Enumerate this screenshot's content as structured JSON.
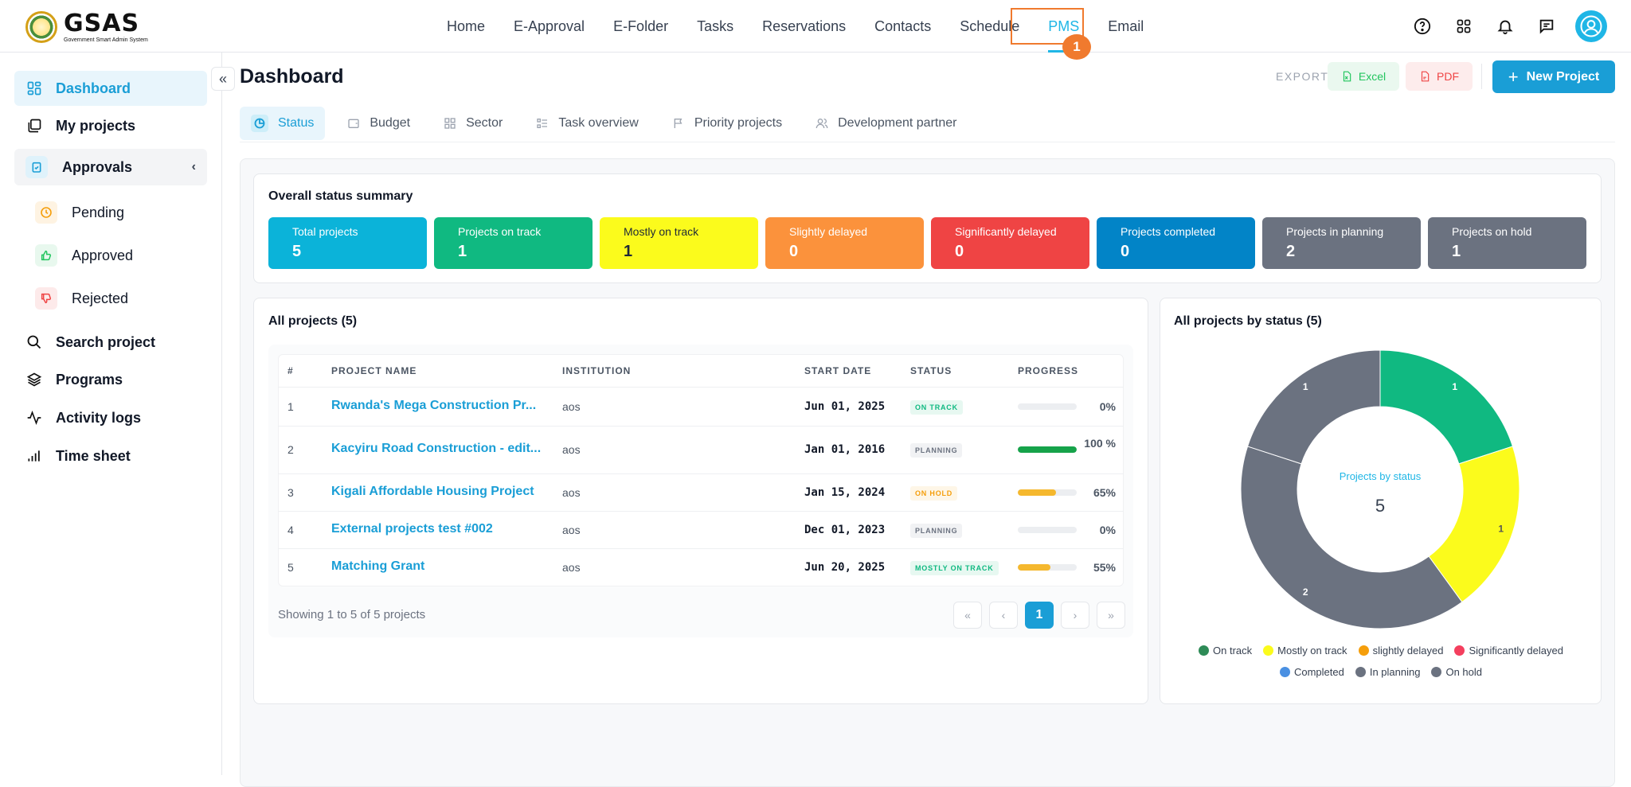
{
  "brand": {
    "title": "GSAS",
    "subtitle": "Government Smart Admin System"
  },
  "nav": [
    {
      "label": "Home",
      "active": false
    },
    {
      "label": "E-Approval",
      "active": false
    },
    {
      "label": "E-Folder",
      "active": false
    },
    {
      "label": "Tasks",
      "active": false
    },
    {
      "label": "Reservations",
      "active": false
    },
    {
      "label": "Contacts",
      "active": false
    },
    {
      "label": "Schedule",
      "active": false
    },
    {
      "label": "PMS",
      "active": true
    },
    {
      "label": "Email",
      "active": false
    }
  ],
  "annotation_badge": "1",
  "top_icons": [
    "help-icon",
    "apps-grid-icon",
    "bell-icon",
    "chat-icon",
    "user-avatar-icon"
  ],
  "sidebar": {
    "items": [
      {
        "label": "Dashboard",
        "icon": "dashboard-icon"
      },
      {
        "label": "My projects",
        "icon": "folders-icon"
      },
      {
        "label": "Approvals",
        "icon": "clipboard-check-icon"
      },
      {
        "label": "Search project",
        "icon": "search-icon"
      },
      {
        "label": "Programs",
        "icon": "layers-icon"
      },
      {
        "label": "Activity logs",
        "icon": "activity-icon"
      },
      {
        "label": "Time sheet",
        "icon": "bar-chart-icon"
      }
    ],
    "approvals_sub": [
      {
        "label": "Pending",
        "icon": "clock-icon",
        "color": "#f59e0b"
      },
      {
        "label": "Approved",
        "icon": "thumbs-up-icon",
        "color": "#22c55e"
      },
      {
        "label": "Rejected",
        "icon": "thumbs-down-icon",
        "color": "#ef4444"
      }
    ]
  },
  "page": {
    "title": "Dashboard",
    "export_label": "EXPORT",
    "excel_label": "Excel",
    "pdf_label": "PDF",
    "new_project_label": "New Project"
  },
  "tabs": [
    {
      "label": "Status",
      "icon": "pie-icon",
      "active": true
    },
    {
      "label": "Budget",
      "icon": "wallet-icon",
      "active": false
    },
    {
      "label": "Sector",
      "icon": "grid-icon",
      "active": false
    },
    {
      "label": "Task overview",
      "icon": "list-icon",
      "active": false
    },
    {
      "label": "Priority projects",
      "icon": "flag-icon",
      "active": false
    },
    {
      "label": "Development partner",
      "icon": "users-icon",
      "active": false
    }
  ],
  "summary": {
    "title": "Overall status summary",
    "stats": [
      {
        "label": "Total projects",
        "value": "5",
        "color": "#0bb3d9"
      },
      {
        "label": "Projects on track",
        "value": "1",
        "color": "#10b981"
      },
      {
        "label": "Mostly on track",
        "value": "1",
        "color": "#fbfb1c"
      },
      {
        "label": "Slightly delayed",
        "value": "0",
        "color": "#fb923c"
      },
      {
        "label": "Significantly delayed",
        "value": "0",
        "color": "#ef4444"
      },
      {
        "label": "Projects completed",
        "value": "0",
        "color": "#0284c7"
      },
      {
        "label": "Projects in planning",
        "value": "2",
        "color": "#6b7280"
      },
      {
        "label": "Projects on hold",
        "value": "1",
        "color": "#6b7280"
      }
    ]
  },
  "projects": {
    "title": "All projects (5)",
    "columns": [
      "#",
      "PROJECT NAME",
      "INSTITUTION",
      "START DATE",
      "STATUS",
      "PROGRESS"
    ],
    "rows": [
      {
        "num": "1",
        "name": "Rwanda's Mega Construction Pr...",
        "institution": "aos",
        "start": "Jun 01, 2025",
        "status": "ON TRACK",
        "status_color": "#10b981",
        "status_bg": "#e7f8f1",
        "progress": 0,
        "progress_label": "0%",
        "bar_color": "#d1d5db"
      },
      {
        "num": "2",
        "name": "Kacyiru Road Construction - edit...",
        "institution": "aos",
        "start": "Jan 01, 2016",
        "status": "PLANNING",
        "status_color": "#6b7280",
        "status_bg": "#f1f2f4",
        "progress": 100,
        "progress_label": "100 %",
        "bar_color": "#16a34a"
      },
      {
        "num": "3",
        "name": "Kigali Affordable Housing Project",
        "institution": "aos",
        "start": "Jan 15, 2024",
        "status": "ON HOLD",
        "status_color": "#f59e0b",
        "status_bg": "#fef6e7",
        "progress": 65,
        "progress_label": "65%",
        "bar_color": "#f5b82e"
      },
      {
        "num": "4",
        "name": "External projects test #002",
        "institution": "aos",
        "start": "Dec 01, 2023",
        "status": "PLANNING",
        "status_color": "#6b7280",
        "status_bg": "#f1f2f4",
        "progress": 0,
        "progress_label": "0%",
        "bar_color": "#d1d5db"
      },
      {
        "num": "5",
        "name": "Matching Grant",
        "institution": "aos",
        "start": "Jun 20, 2025",
        "status": "MOSTLY ON TRACK",
        "status_color": "#10b981",
        "status_bg": "#e7f8f1",
        "progress": 55,
        "progress_label": "55%",
        "bar_color": "#f5b82e"
      }
    ],
    "showing": "Showing 1 to 5 of 5 projects",
    "pagination": {
      "first": "«",
      "prev": "‹",
      "current": "1",
      "next": "›",
      "last": "»"
    }
  },
  "chart_data": {
    "type": "pie",
    "title": "All projects by status (5)",
    "center_label": "Projects by status",
    "center_value": "5",
    "slices": [
      {
        "label": "On track",
        "value": 1,
        "color": "#10b981"
      },
      {
        "label": "Mostly on track",
        "value": 1,
        "color": "#fbfb1c"
      },
      {
        "label": "In planning",
        "value": 2,
        "color": "#6b7280"
      },
      {
        "label": "On hold",
        "value": 1,
        "color": "#6b7280"
      }
    ],
    "legend": [
      {
        "label": "On track",
        "color": "#2e8b57"
      },
      {
        "label": "Mostly on track",
        "color": "#fbfb1c"
      },
      {
        "label": "slightly delayed",
        "color": "#f59e0b"
      },
      {
        "label": "Significantly delayed",
        "color": "#f43f5e"
      },
      {
        "label": "Completed",
        "color": "#4a90e2"
      },
      {
        "label": "In planning",
        "color": "#6b7280"
      },
      {
        "label": "On hold",
        "color": "#6b7280"
      }
    ],
    "legend_position": "bottom"
  }
}
